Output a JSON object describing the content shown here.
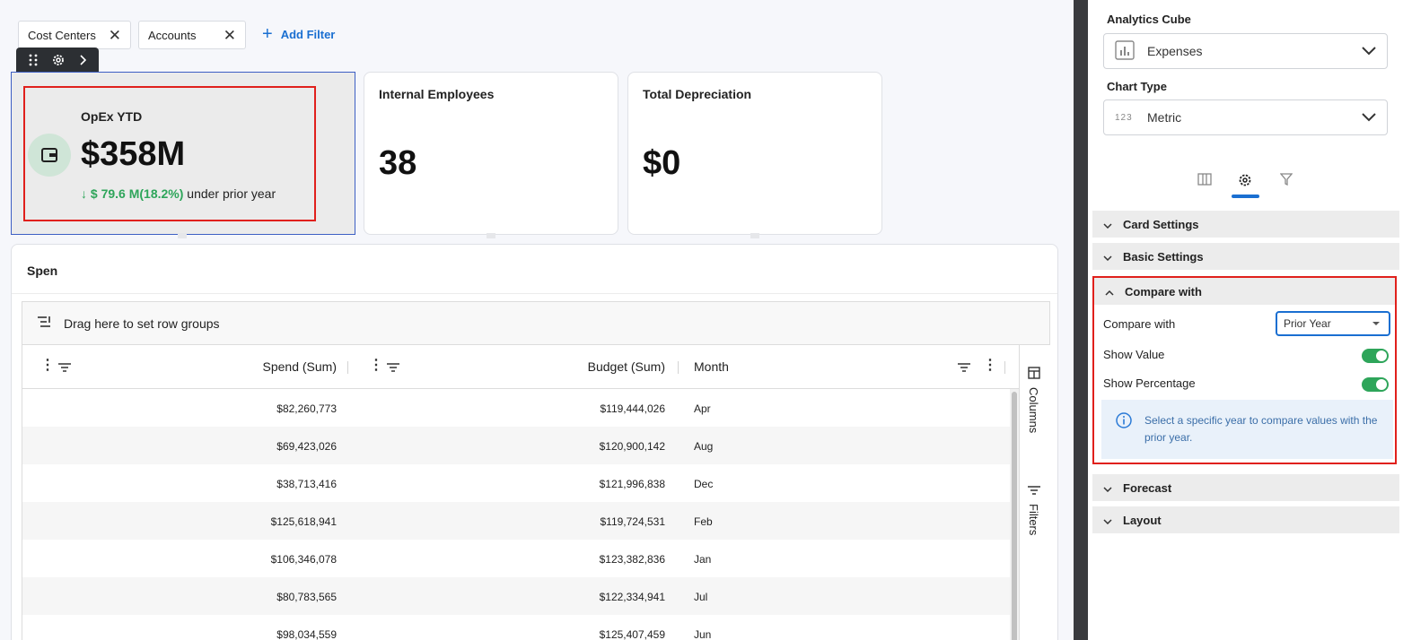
{
  "filters": {
    "chips": [
      {
        "label": "Cost Centers"
      },
      {
        "label": "Accounts"
      }
    ],
    "add_label": "Add Filter"
  },
  "cards": {
    "opex": {
      "title": "OpEx YTD",
      "value": "$358M",
      "delta": "↓ $ 79.6 M(18.2%)",
      "compare_text": "under prior year"
    },
    "employees": {
      "title": "Internal Employees",
      "value": "38"
    },
    "depreciation": {
      "title": "Total Depreciation",
      "value": "$0"
    }
  },
  "panel": {
    "title": "Spen",
    "group_bar_label": "Drag here to set row groups",
    "columns": [
      "Spend (Sum)",
      "Budget (Sum)",
      "Month"
    ],
    "rows": [
      [
        "$82,260,773",
        "$119,444,026",
        "Apr"
      ],
      [
        "$69,423,026",
        "$120,900,142",
        "Aug"
      ],
      [
        "$38,713,416",
        "$121,996,838",
        "Dec"
      ],
      [
        "$125,618,941",
        "$119,724,531",
        "Feb"
      ],
      [
        "$106,346,078",
        "$123,382,836",
        "Jan"
      ],
      [
        "$80,783,565",
        "$122,334,941",
        "Jul"
      ],
      [
        "$98,034,559",
        "$125,407,459",
        "Jun"
      ]
    ],
    "side_tabs": {
      "columns": "Columns",
      "filters": "Filters"
    }
  },
  "settings": {
    "cube_label": "Analytics Cube",
    "cube_value": "Expenses",
    "chart_type_label": "Chart Type",
    "chart_type_value": "Metric",
    "chart_type_icon_text": "123",
    "sections": {
      "card_settings": "Card Settings",
      "basic_settings": "Basic Settings",
      "compare_with": "Compare with",
      "forecast": "Forecast",
      "layout": "Layout"
    },
    "compare": {
      "compare_label": "Compare with",
      "compare_value": "Prior Year",
      "show_value_label": "Show Value",
      "show_value_on": true,
      "show_percentage_label": "Show Percentage",
      "show_percentage_on": true,
      "info_text": "Select a specific year to compare values with the prior year."
    }
  },
  "colors": {
    "accent": "#1a6fd1",
    "positive": "#2ea55a",
    "highlight": "#e0201c",
    "splitter": "#3a3b3e"
  }
}
